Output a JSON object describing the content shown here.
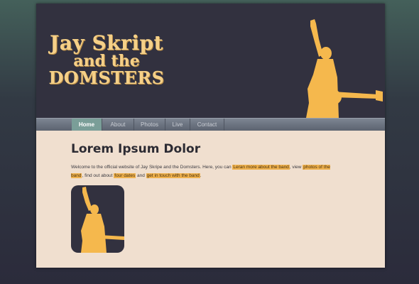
{
  "logo": {
    "line1": "Jay Skript",
    "line2": "and the",
    "line3": "DOMSTERS"
  },
  "nav": {
    "items": [
      {
        "label": "Home",
        "active": true
      },
      {
        "label": "About",
        "active": false
      },
      {
        "label": "Photos",
        "active": false
      },
      {
        "label": "Live",
        "active": false
      },
      {
        "label": "Contact",
        "active": false
      }
    ]
  },
  "main": {
    "title": "Lorem Ipsum Dolor",
    "intro": {
      "t1": "Welcome to the official website of Jay Skripe and the Domsters. Here, you can ",
      "link_about": "Leran more about the band",
      "t2": ", view ",
      "link_photos": "photos of the band",
      "t3": ", find out about ",
      "link_tour": "four dates",
      "t4": " and ",
      "link_contact": "get in touch with the band",
      "t5": "."
    }
  },
  "colors": {
    "header_bg": "#32313f",
    "content_bg": "#f0dfcf",
    "accent": "#f5b84d",
    "nav_active": "#7a9e98"
  },
  "icons": {
    "header_image": "guitarist-silhouette-icon",
    "thumbnail": "guitarist-silhouette-icon"
  }
}
